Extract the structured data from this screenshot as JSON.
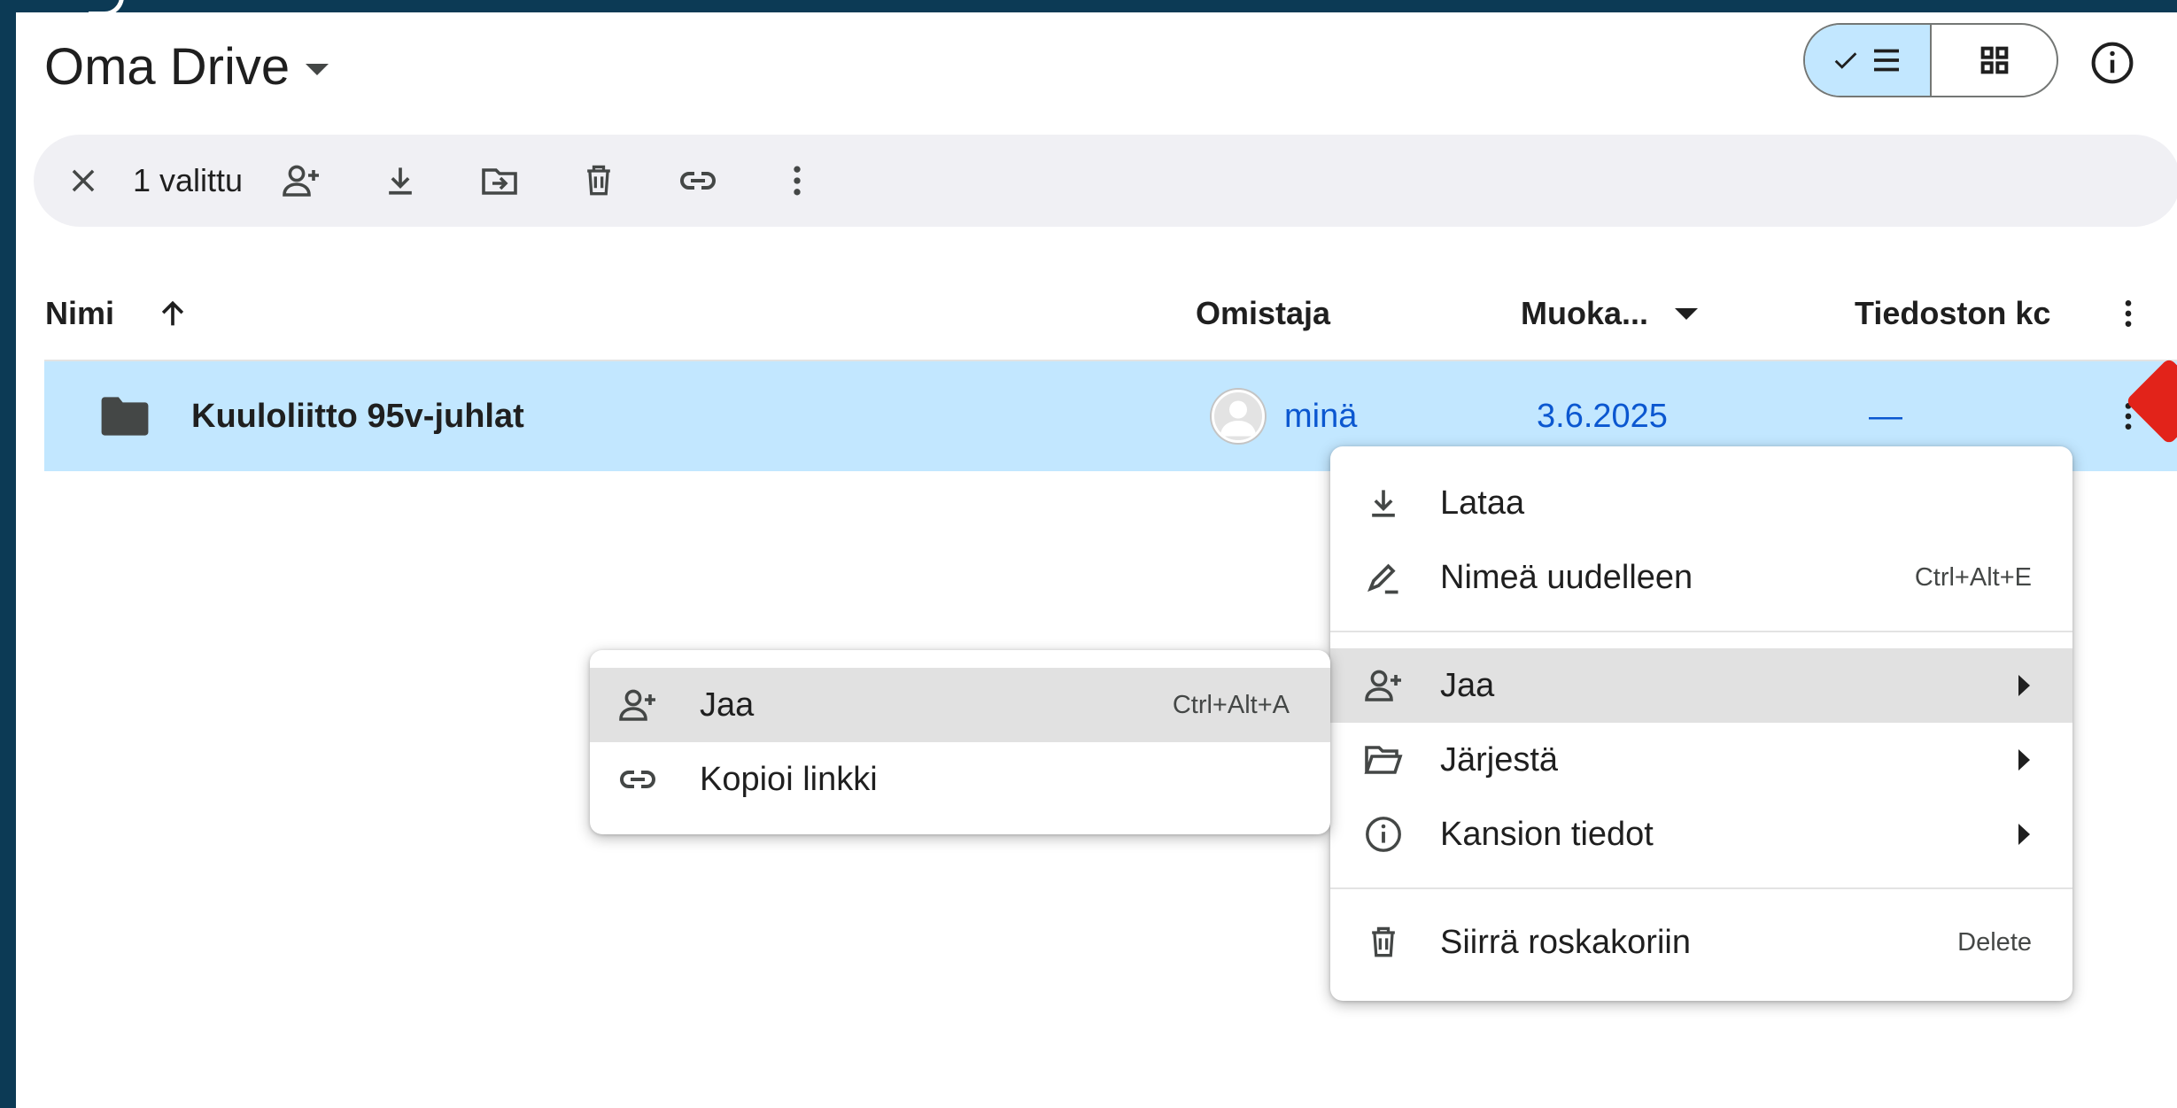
{
  "header": {
    "title": "Oma Drive"
  },
  "toolbar": {
    "selected_count": "1 valittu"
  },
  "columns": {
    "name": "Nimi",
    "owner": "Omistaja",
    "modified": "Muoka...",
    "size": "Tiedoston kc"
  },
  "row": {
    "name": "Kuuloliitto 95v-juhlat",
    "owner": "minä",
    "modified": "3.6.2025",
    "size": "—"
  },
  "context_menu": {
    "download": "Lataa",
    "rename": "Nimeä uudelleen",
    "rename_shortcut": "Ctrl+Alt+E",
    "share": "Jaa",
    "organize": "Järjestä",
    "folder_info": "Kansion tiedot",
    "trash": "Siirrä roskakoriin",
    "trash_shortcut": "Delete"
  },
  "share_submenu": {
    "share": "Jaa",
    "share_shortcut": "Ctrl+Alt+A",
    "copy_link": "Kopioi linkki"
  },
  "colors": {
    "selected_row": "#c2e7ff",
    "link_blue": "#0b57d0",
    "frame": "#0c3a55",
    "marker": "#e2231a"
  }
}
